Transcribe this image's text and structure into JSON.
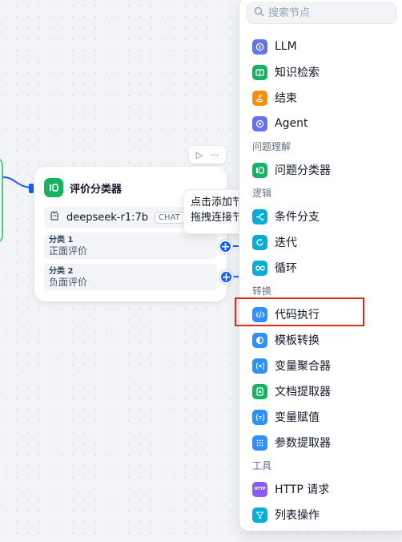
{
  "canvas": {
    "node": {
      "title": "评价分类器",
      "model_name": "deepseek-r1:7b",
      "model_mode": "CHAT",
      "classes": [
        {
          "name": "分类 1",
          "desc": "正面评价"
        },
        {
          "name": "分类 2",
          "desc": "负面评价"
        }
      ],
      "toolbar": {
        "run_glyph": "▷",
        "more_glyph": "···"
      }
    },
    "tooltip": {
      "line1": "点击添加节点",
      "line2": "拖拽连接节点"
    }
  },
  "block_selector": {
    "search_placeholder": "搜索节点",
    "groups": [
      {
        "label": "",
        "items": [
          {
            "label": "LLM",
            "icon": "llm-icon",
            "color": "#6172f3"
          },
          {
            "label": "知识检索",
            "icon": "knowledge-retrieval-icon",
            "color": "#16b364"
          },
          {
            "label": "结束",
            "icon": "end-icon",
            "color": "#f79009"
          },
          {
            "label": "Agent",
            "icon": "agent-icon",
            "color": "#6172f3"
          }
        ]
      },
      {
        "label": "问题理解",
        "items": [
          {
            "label": "问题分类器",
            "icon": "question-classifier-icon",
            "color": "#16b364"
          }
        ]
      },
      {
        "label": "逻辑",
        "items": [
          {
            "label": "条件分支",
            "icon": "if-else-icon",
            "color": "#06aed4"
          },
          {
            "label": "迭代",
            "icon": "iteration-icon",
            "color": "#06aed4"
          },
          {
            "label": "循环",
            "icon": "loop-icon",
            "color": "#06aed4"
          }
        ]
      },
      {
        "label": "转换",
        "items": [
          {
            "label": "代码执行",
            "icon": "code-icon",
            "color": "#2e90fa"
          },
          {
            "label": "模板转换",
            "icon": "template-transform-icon",
            "color": "#2e90fa"
          },
          {
            "label": "变量聚合器",
            "icon": "variable-aggregator-icon",
            "color": "#2e90fa"
          },
          {
            "label": "文档提取器",
            "icon": "document-extractor-icon",
            "color": "#16b364"
          },
          {
            "label": "变量赋值",
            "icon": "variable-assigner-icon",
            "color": "#2e90fa"
          },
          {
            "label": "参数提取器",
            "icon": "parameter-extractor-icon",
            "color": "#2e90fa"
          }
        ]
      },
      {
        "label": "工具",
        "items": [
          {
            "label": "HTTP 请求",
            "icon": "http-request-icon",
            "color": "#875bf7"
          },
          {
            "label": "列表操作",
            "icon": "list-operator-icon",
            "color": "#06aed4"
          }
        ]
      }
    ],
    "highlighted_item": "代码执行"
  }
}
